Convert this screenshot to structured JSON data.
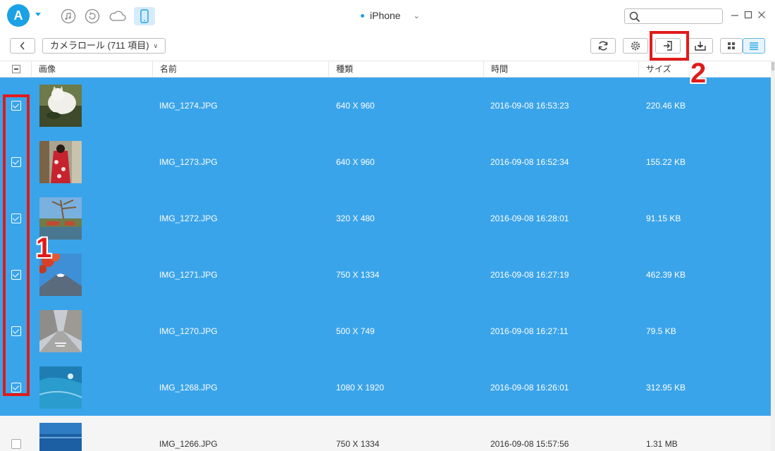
{
  "titlebar": {
    "device_name": "iPhone",
    "icons": [
      "app-logo-icon",
      "music-icon",
      "restore-icon",
      "cloud-icon",
      "phone-icon",
      "search-icon"
    ],
    "window_controls": [
      "minimize",
      "maximize",
      "close"
    ]
  },
  "toolbar": {
    "album_label": "カメラロール (711 項目)",
    "buttons": [
      "back-icon",
      "refresh-icon",
      "settings-icon",
      "export-to-pc-icon",
      "import-icon",
      "grid-view-icon",
      "list-view-icon"
    ]
  },
  "table": {
    "columns": [
      "画像",
      "名前",
      "種類",
      "時間",
      "サイズ"
    ],
    "rows": [
      {
        "name": "IMG_1274.JPG",
        "type": "640 X 960",
        "time": "2016-09-08 16:53:23",
        "size": "220.46 KB",
        "selected": true
      },
      {
        "name": "IMG_1273.JPG",
        "type": "640 X 960",
        "time": "2016-09-08 16:52:34",
        "size": "155.22 KB",
        "selected": true
      },
      {
        "name": "IMG_1272.JPG",
        "type": "320 X 480",
        "time": "2016-09-08 16:28:01",
        "size": "91.15 KB",
        "selected": true
      },
      {
        "name": "IMG_1271.JPG",
        "type": "750 X 1334",
        "time": "2016-09-08 16:27:19",
        "size": "462.39 KB",
        "selected": true
      },
      {
        "name": "IMG_1270.JPG",
        "type": "500 X 749",
        "time": "2016-09-08 16:27:11",
        "size": "79.5 KB",
        "selected": true
      },
      {
        "name": "IMG_1268.JPG",
        "type": "1080 X 1920",
        "time": "2016-09-08 16:26:01",
        "size": "312.95 KB",
        "selected": true
      },
      {
        "name": "IMG_1266.JPG",
        "type": "750 X 1334",
        "time": "2016-09-08 15:57:56",
        "size": "1.31 MB",
        "selected": false
      }
    ]
  },
  "annotations": {
    "step1": "1",
    "step2": "2"
  },
  "colors": {
    "accent": "#1ba1e6",
    "selected_row": "#3aa4ea",
    "highlight": "#e01b1b"
  }
}
